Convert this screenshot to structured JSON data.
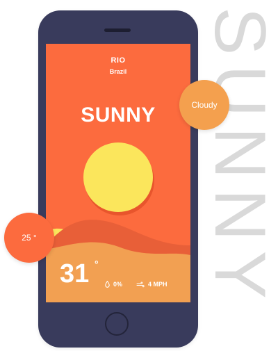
{
  "background": {
    "watermark_text": "SUNNY"
  },
  "weather": {
    "city": "RIO",
    "country": "Brazil",
    "condition": "SUNNY",
    "temperature": "31",
    "degree_symbol": "°",
    "humidity": "0%",
    "wind": "4 MPH"
  },
  "bubbles": {
    "cloudy_label": "Cloudy",
    "temp_label": "25 °"
  },
  "icons": {
    "humidity": "droplet-icon",
    "wind": "wind-icon"
  },
  "colors": {
    "phone_body": "#393b5c",
    "screen_background": "#fc6b3e",
    "sun": "#fbe65c",
    "hill_light": "#f2a052",
    "wave_yellow": "#fbe65c",
    "cloudy_bubble": "#f4a04e",
    "temp_bubble": "#fc6b3e",
    "watermark": "#d9d9d9"
  }
}
